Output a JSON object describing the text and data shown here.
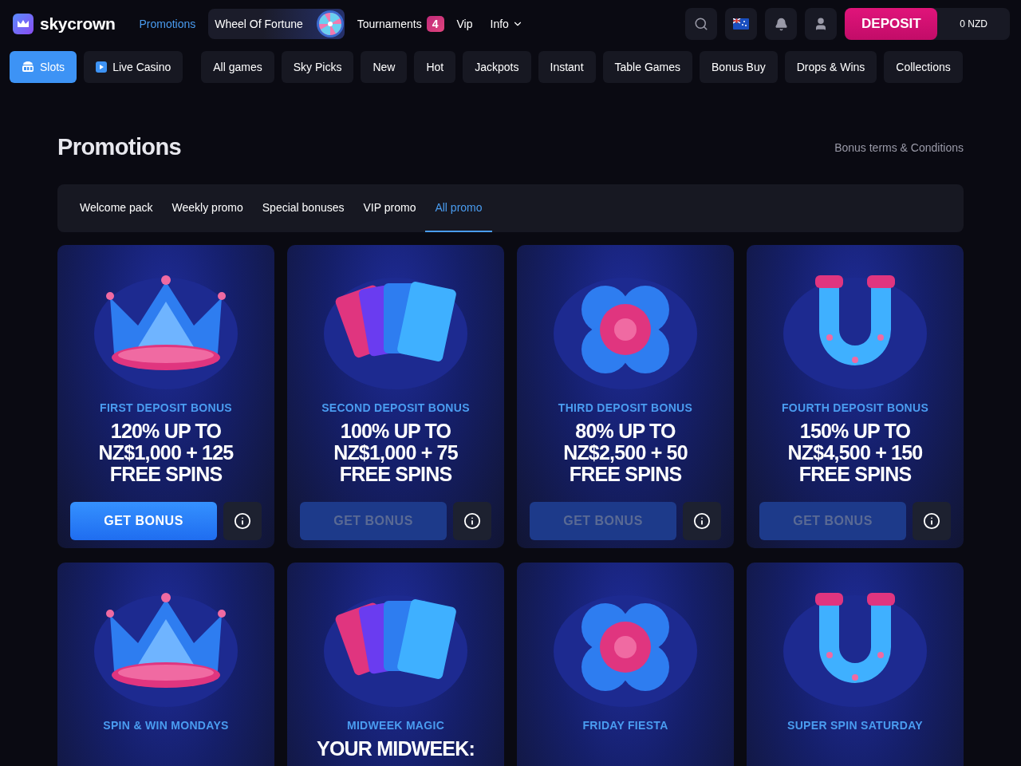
{
  "header": {
    "logo": "skycrown",
    "nav": [
      {
        "label": "Promotions",
        "selected": true,
        "kind": "link"
      },
      {
        "label": "Wheel Of Fortune",
        "selected": false,
        "kind": "wheel"
      },
      {
        "label": "Tournaments",
        "selected": false,
        "kind": "link",
        "badge": "4"
      },
      {
        "label": "Vip",
        "selected": false,
        "kind": "link"
      },
      {
        "label": "Info",
        "selected": false,
        "kind": "dropdown"
      }
    ],
    "deposit": "DEPOSIT",
    "balance": "0 NZD"
  },
  "categories": [
    {
      "label": "Slots",
      "selected": true,
      "kind": "slots"
    },
    {
      "label": "Live Casino",
      "selected": false,
      "kind": "live"
    },
    {
      "label": "All games",
      "selected": false,
      "kind": "plain"
    },
    {
      "label": "Sky Picks",
      "selected": false,
      "kind": "plain"
    },
    {
      "label": "New",
      "selected": false,
      "kind": "plain"
    },
    {
      "label": "Hot",
      "selected": false,
      "kind": "plain"
    },
    {
      "label": "Jackpots",
      "selected": false,
      "kind": "plain"
    },
    {
      "label": "Instant",
      "selected": false,
      "kind": "plain"
    },
    {
      "label": "Table Games",
      "selected": false,
      "kind": "plain"
    },
    {
      "label": "Bonus Buy",
      "selected": false,
      "kind": "plain"
    },
    {
      "label": "Drops & Wins",
      "selected": false,
      "kind": "plain"
    },
    {
      "label": "Collections",
      "selected": false,
      "kind": "plain"
    }
  ],
  "page": {
    "title": "Promotions",
    "terms_link": "Bonus terms & Conditions"
  },
  "tabs": [
    {
      "label": "Welcome pack",
      "selected": false
    },
    {
      "label": "Weekly promo",
      "selected": false
    },
    {
      "label": "Special bonuses",
      "selected": false
    },
    {
      "label": "VIP promo",
      "selected": false
    },
    {
      "label": "All promo",
      "selected": true
    }
  ],
  "promos": [
    {
      "label": "FIRST DEPOSIT BONUS",
      "headline": "120% UP TO\nNZ$1,000 + 125\nFREE SPINS",
      "button": "GET BONUS",
      "disabled": false
    },
    {
      "label": "SECOND DEPOSIT BONUS",
      "headline": "100% UP TO\nNZ$1,000 + 75\nFREE SPINS",
      "button": "GET BONUS",
      "disabled": true
    },
    {
      "label": "THIRD DEPOSIT BONUS",
      "headline": "80% UP TO\nNZ$2,500 + 50\nFREE SPINS",
      "button": "GET BONUS",
      "disabled": true
    },
    {
      "label": "FOURTH DEPOSIT BONUS",
      "headline": "150% UP TO\nNZ$4,500 + 150\nFREE SPINS",
      "button": "GET BONUS",
      "disabled": true
    },
    {
      "label": "SPIN & WIN MONDAYS"
    },
    {
      "label": "MIDWEEK MAGIC",
      "headline": "YOUR MIDWEEK:"
    },
    {
      "label": "FRIDAY FIESTA"
    },
    {
      "label": "SUPER SPIN SATURDAY"
    }
  ]
}
